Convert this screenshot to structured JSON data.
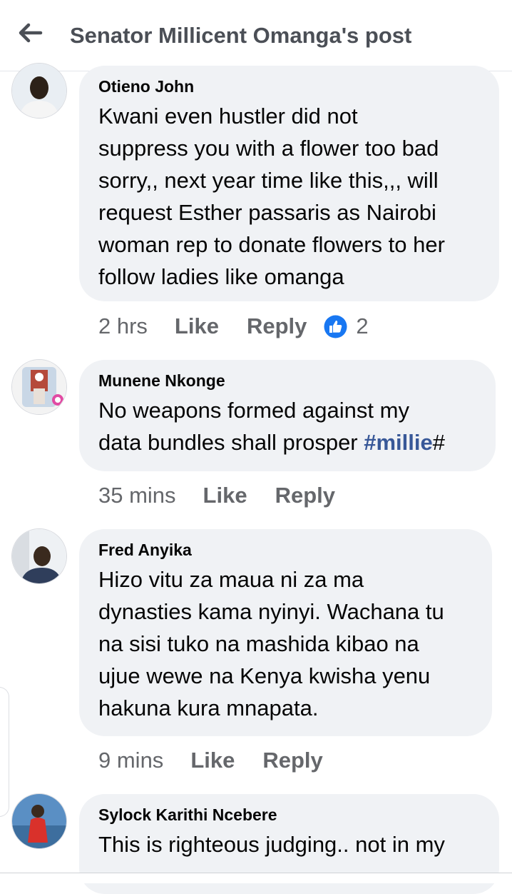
{
  "header": {
    "title": "Senator Millicent Omanga's post",
    "back_icon": "arrow-left-icon"
  },
  "colors": {
    "bubble_bg": "#f0f2f5",
    "meta_text": "#65676b",
    "hashtag": "#385898",
    "like_badge": "#1877f2"
  },
  "comments": [
    {
      "author": "Otieno John",
      "lines": [
        "Kwani even hustler did not",
        "suppress you with a flower too bad",
        "sorry,, next year time like this,,, will",
        "request Esther passaris as Nairobi",
        "woman rep to donate flowers to her",
        "follow ladies like omanga"
      ],
      "time": "2 hrs",
      "like_label": "Like",
      "reply_label": "Reply",
      "reaction_icon": "like-reaction-icon",
      "reaction_count": "2"
    },
    {
      "author": "Munene Nkonge",
      "line1": "No weapons formed against my",
      "line2_text": "data bundles shall prosper ",
      "hashtag": "#millie",
      "hashtag_suffix": "#",
      "time": "35 mins",
      "like_label": "Like",
      "reply_label": "Reply"
    },
    {
      "author": "Fred Anyika",
      "lines": [
        "Hizo vitu za maua ni za ma",
        "dynasties kama nyinyi. Wachana tu",
        "na sisi tuko na mashida kibao na",
        "ujue wewe na Kenya kwisha yenu",
        "hakuna kura mnapata."
      ],
      "time": "9 mins",
      "like_label": "Like",
      "reply_label": "Reply"
    },
    {
      "author": "Sylock Karithi Ncebere",
      "lines": [
        "This is righteous judging.. not in my"
      ]
    }
  ]
}
